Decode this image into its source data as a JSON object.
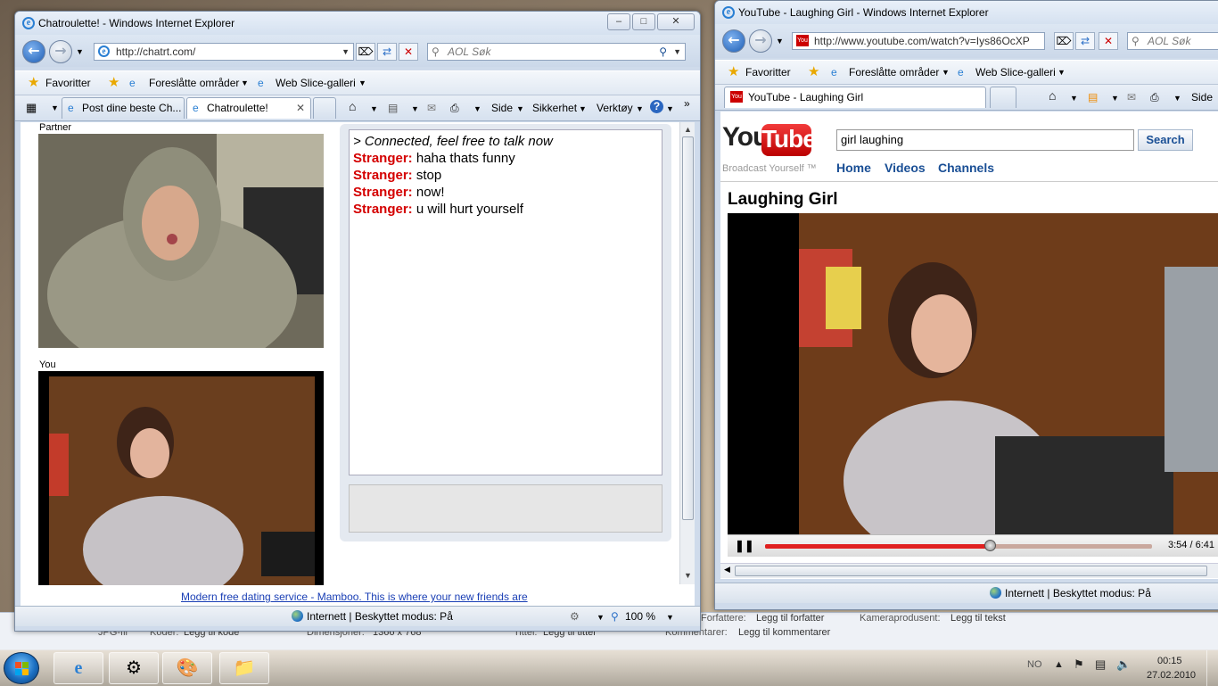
{
  "explorer_details": {
    "type_value": "JPG-fil",
    "codes_label": "Koder:",
    "codes_value": "Legg til kode",
    "dims_label": "Dimensjoner:",
    "dims_value": "1366 x 768",
    "title_label": "Tittel:",
    "title_value": "Legg til tittel",
    "comments_label": "Kommentarer:",
    "comments_value": "Legg til kommentarer",
    "authors_label": "Forfattere:",
    "authors_value": "Legg til forfatter",
    "camera_label": "Kameraprodusent:",
    "camera_value": "Legg til tekst"
  },
  "left_window": {
    "title": "Chatroulette! - Windows Internet Explorer",
    "url": "http://chatrt.com/",
    "search_placeholder": "AOL Søk",
    "fav_label": "Favoritter",
    "suggested_sites": "Foreslåtte områder",
    "web_slice": "Web Slice-galleri",
    "tabs": [
      {
        "label": "Post dine beste Ch..."
      },
      {
        "label": "Chatroulette!"
      }
    ],
    "cmd": {
      "page": "Side",
      "safety": "Sikkerhet",
      "tools": "Verktøy"
    },
    "status_zone": "Internett | Beskyttet modus: På",
    "zoom": "100 %"
  },
  "chatroulette": {
    "partner_label": "Partner",
    "you_label": "You",
    "messages": [
      {
        "who": "",
        "text": "> Connected, feel free to talk now"
      },
      {
        "who": "Stranger:",
        "text": "haha thats funny"
      },
      {
        "who": "Stranger:",
        "text": "stop"
      },
      {
        "who": "Stranger:",
        "text": "now!"
      },
      {
        "who": "Stranger:",
        "text": "u will hurt yourself"
      }
    ],
    "ad_link": "Modern free dating service - Mamboo. This is where your new friends are"
  },
  "right_window": {
    "title": "YouTube - Laughing Girl - Windows Internet Explorer",
    "url": "http://www.youtube.com/watch?v=Iys86OcXP",
    "search_placeholder": "AOL Søk",
    "fav_label": "Favoritter",
    "suggested_sites": "Foreslåtte områder",
    "web_slice": "Web Slice-galleri",
    "tab_label": "YouTube - Laughing Girl",
    "cmd": {
      "page": "Side"
    },
    "status_zone": "Internett | Beskyttet modus: På"
  },
  "youtube": {
    "logo_you": "You",
    "logo_tube": "Tube",
    "tagline": "Broadcast Yourself ™",
    "search_value": "girl laughing",
    "search_button": "Search",
    "nav": [
      "Home",
      "Videos",
      "Channels"
    ],
    "video_title": "Laughing Girl",
    "time": "3:54 / 6:41",
    "progress": 0.58
  },
  "taskbar": {
    "lang": "NO",
    "time": "00:15",
    "date": "27.02.2010"
  },
  "colors": {
    "stranger": "#d40000",
    "link": "#1a3fb5",
    "yt_red": "#cc0000",
    "yt_blue": "#1a4f95"
  }
}
